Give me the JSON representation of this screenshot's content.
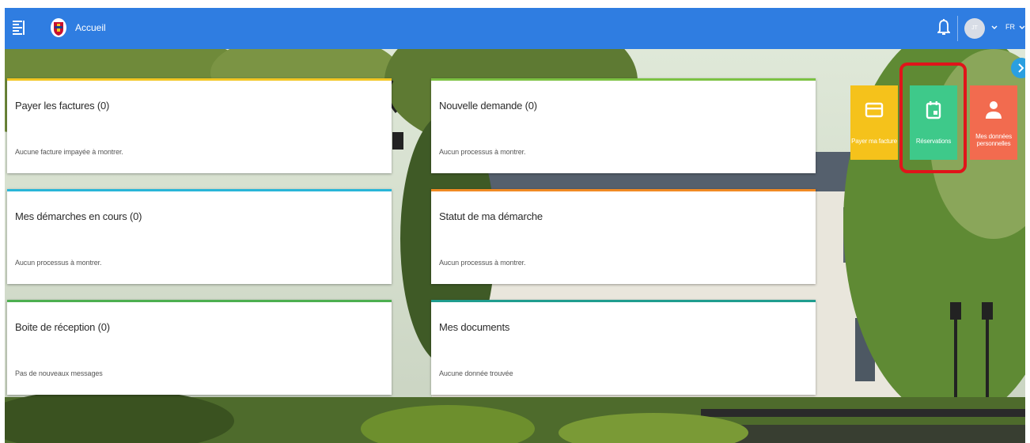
{
  "header": {
    "title": "Accueil",
    "avatar_initials": "JT",
    "language": "FR",
    "icons": [
      "menu-icon",
      "city-logo",
      "bell-icon",
      "chevron-down-icon"
    ]
  },
  "cards": [
    {
      "title": "Payer les factures (0)",
      "text": "Aucune facture impayée à montrer.",
      "accent": "#f2c623"
    },
    {
      "title": "Nouvelle demande (0)",
      "text": "Aucun processus à montrer.",
      "accent": "#7cc243"
    },
    {
      "title": "Mes démarches en cours (0)",
      "text": "Aucun processus à montrer.",
      "accent": "#29b6d8"
    },
    {
      "title": "Statut de ma démarche",
      "text": "Aucun processus à montrer.",
      "accent": "#f08a24"
    },
    {
      "title": "Boite de réception (0)",
      "text": "Pas de nouveaux messages",
      "accent": "#4caf50"
    },
    {
      "title": "Mes documents",
      "text": "Aucune donnée trouvée",
      "accent": "#1f9d8f"
    }
  ],
  "tiles": [
    {
      "label": "Payer ma facture",
      "color": "#f5c21b",
      "icon": "invoice-icon"
    },
    {
      "label": "Réservations",
      "color": "#3ec98a",
      "icon": "calendar-icon",
      "highlighted": true
    },
    {
      "label": "Mes données personnelles",
      "color": "#f26b4f",
      "icon": "person-icon"
    }
  ],
  "colors": {
    "header_bg": "#2f7de1",
    "highlight": "#e0141a",
    "next_button": "#2a9fe0"
  }
}
